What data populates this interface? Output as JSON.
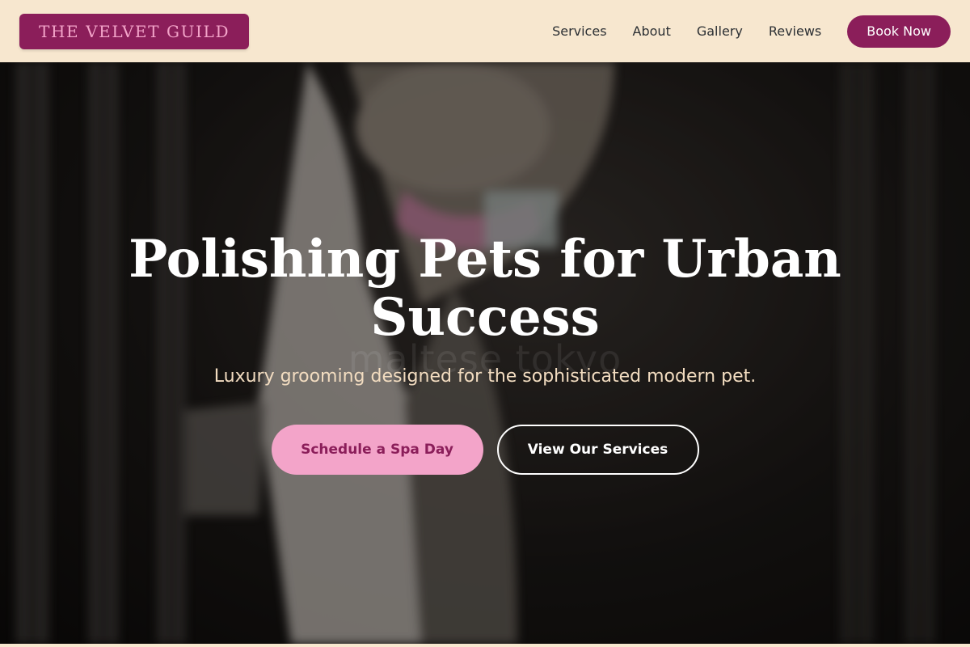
{
  "nav": {
    "logo": "THE VELVET GUILD",
    "links": [
      "Services",
      "About",
      "Gallery",
      "Reviews"
    ],
    "cta": "Book Now"
  },
  "hero": {
    "title": "Polishing Pets for Urban Success",
    "subtitle": "Luxury grooming designed for the sophisticated modern pet.",
    "watermark": "maltese tokyo",
    "primary_button": "Schedule a Spa Day",
    "secondary_button": "View Our Services",
    "background_image": "blurred-cat-photo"
  },
  "colors": {
    "cream": "#f7e7cf",
    "plum": "#8b1e5a",
    "pink": "#f3a4c9",
    "subtitle": "#f2dcc0"
  }
}
